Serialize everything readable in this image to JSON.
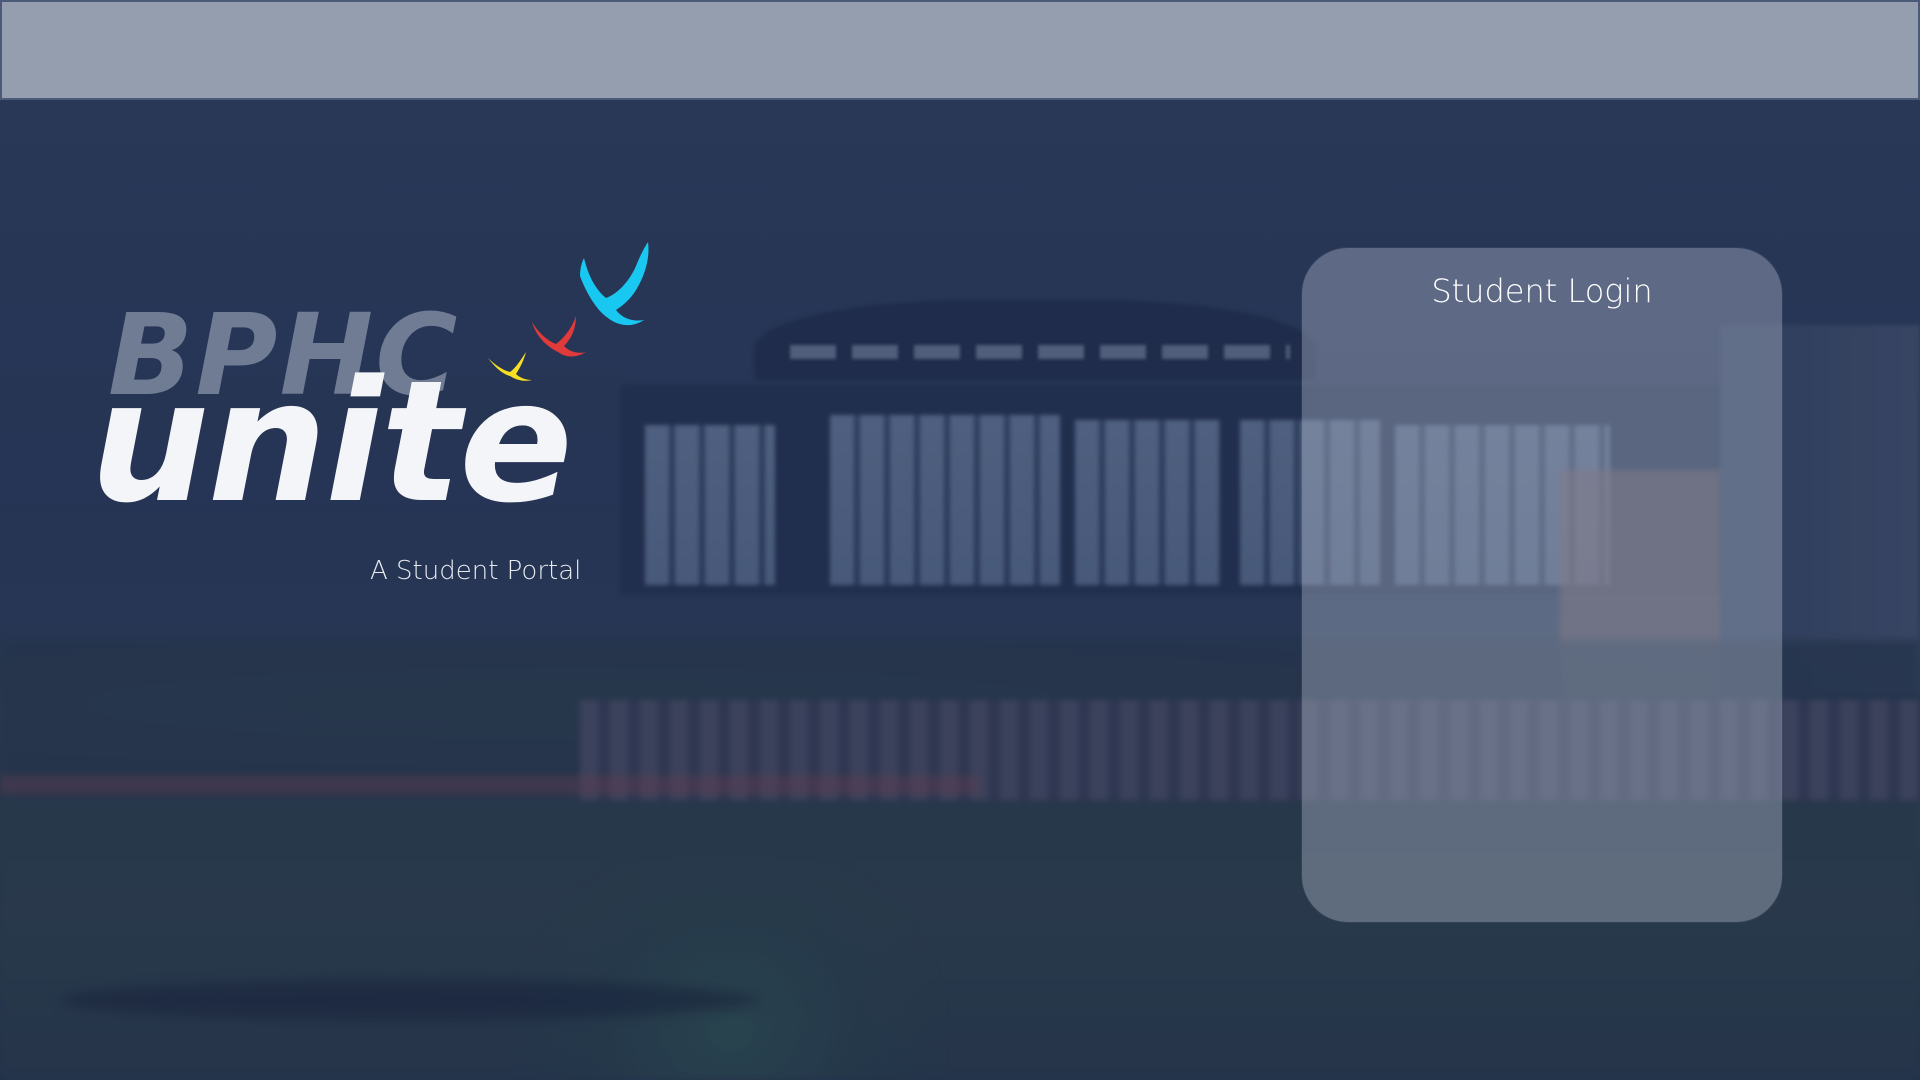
{
  "brand": {
    "prefix": "BPHC",
    "name": "unite",
    "tagline": "A Student Portal",
    "bird_colors": [
      "#f5e022",
      "#e03a3a",
      "#18c8f0"
    ]
  },
  "login": {
    "title": "Student Login"
  },
  "icons": {
    "birds": "flying-birds-icon"
  },
  "colors": {
    "top_bar": "#949eae",
    "overlay": "#1e2d50",
    "card": "#aab2c6"
  }
}
